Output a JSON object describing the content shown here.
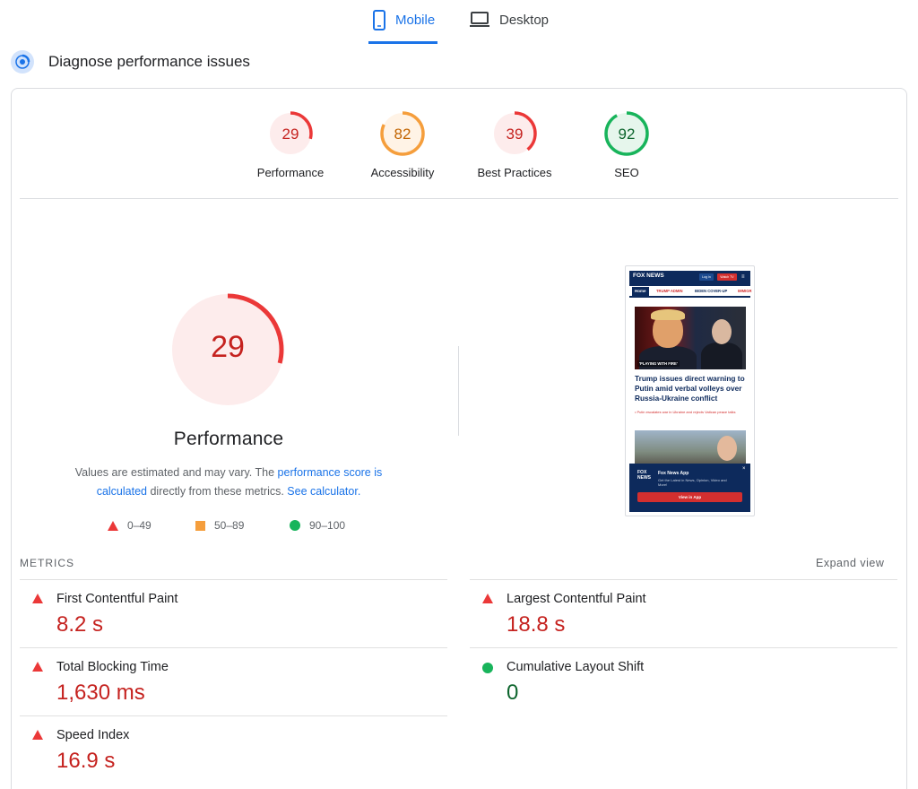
{
  "tabs": {
    "mobile": "Mobile",
    "desktop": "Desktop"
  },
  "header": {
    "title": "Diagnose performance issues"
  },
  "scores": [
    {
      "label": "Performance",
      "value": "29",
      "fraction": 0.29,
      "color": "#eb3838",
      "bg": "#fdecec"
    },
    {
      "label": "Accessibility",
      "value": "82",
      "fraction": 0.82,
      "color": "#f59e3c",
      "bg": "#fff3e6"
    },
    {
      "label": "Best Practices",
      "value": "39",
      "fraction": 0.39,
      "color": "#eb3838",
      "bg": "#fdecec"
    },
    {
      "label": "SEO",
      "value": "92",
      "fraction": 0.92,
      "color": "#18b45b",
      "bg": "#e6f6ec"
    }
  ],
  "performance": {
    "score": "29",
    "fraction": 0.29,
    "title": "Performance",
    "desc_1": "Values are estimated and may vary. The ",
    "desc_link_1": "performance score is calculated",
    "desc_2": " directly from these metrics. ",
    "desc_link_2": "See calculator.",
    "legend": {
      "poor": "0–49",
      "average": "50–89",
      "good": "90–100"
    }
  },
  "screenshot": {
    "logo": "FOX NEWS",
    "login": "Log In",
    "watch": "Watch TV",
    "menu": "≡",
    "nav": [
      "Home",
      "TRUMP ADMIN",
      "BIDEN COVER-UP",
      "IMMIGR"
    ],
    "caption": "'PLAYING WITH FIRE'",
    "headline": "Trump issues direct warning to Putin amid verbal volleys over Russia-Ukraine conflict",
    "bullet": "• Putin escalates war in Ukraine and rejects Vatican peace talks",
    "banner_logo": "FOX NEWS",
    "banner_title": "Fox News App",
    "banner_sub": "Get the Latest in News, Opinion, Video and More!",
    "banner_close": "×",
    "banner_btn": "View in App"
  },
  "metrics": {
    "label": "METRICS",
    "expand": "Expand view",
    "items": [
      {
        "name": "First Contentful Paint",
        "value": "8.2 s",
        "status": "poor"
      },
      {
        "name": "Largest Contentful Paint",
        "value": "18.8 s",
        "status": "poor"
      },
      {
        "name": "Total Blocking Time",
        "value": "1,630 ms",
        "status": "poor"
      },
      {
        "name": "Cumulative Layout Shift",
        "value": "0",
        "status": "good"
      },
      {
        "name": "Speed Index",
        "value": "16.9 s",
        "status": "poor"
      }
    ]
  },
  "colors": {
    "accent": "#1a73e8",
    "poor": "#eb3838",
    "average": "#f59e3c",
    "good": "#18b45b"
  }
}
